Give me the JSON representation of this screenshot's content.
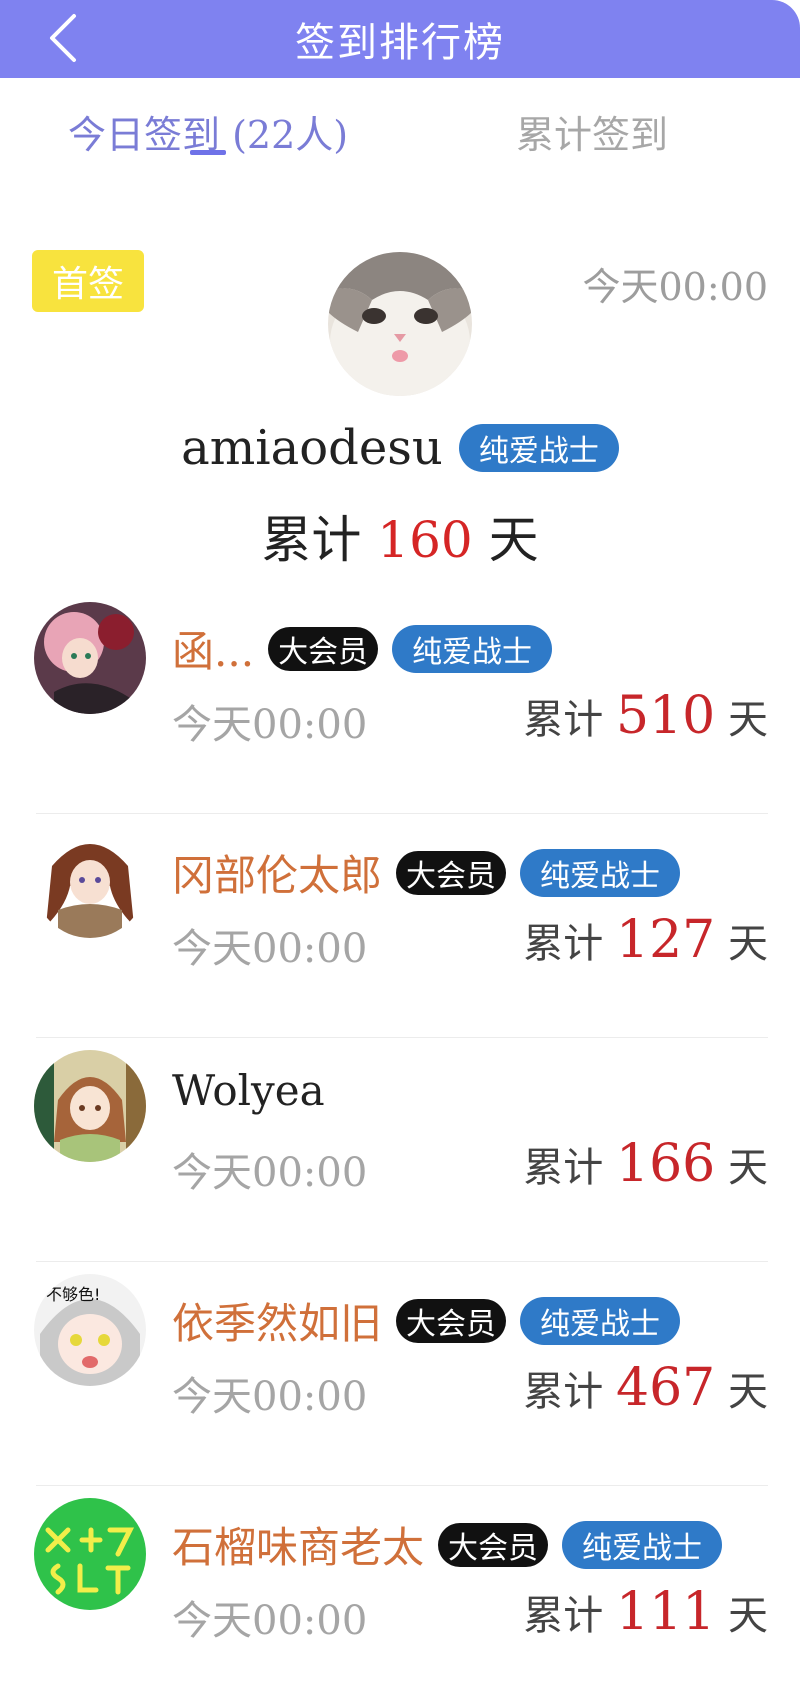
{
  "header": {
    "title": "签到排行榜"
  },
  "tabs": [
    {
      "label": "今日签到 (22人)"
    },
    {
      "label": "累计签到"
    }
  ],
  "first": {
    "badge": "首签",
    "time": "今天00:00",
    "name": "amiaodesu",
    "tag": "纯爱战士",
    "total_prefix": "累计",
    "total_days": "160",
    "total_suffix": "天"
  },
  "labels": {
    "total_prefix": "累计",
    "total_suffix": "天"
  },
  "list": [
    {
      "name": "函...",
      "vip": "大会员",
      "tag": "纯爱战士",
      "time": "今天00:00",
      "days": "510"
    },
    {
      "name": "冈部伦太郎",
      "vip": "大会员",
      "tag": "纯爱战士",
      "time": "今天00:00",
      "days": "127"
    },
    {
      "name": "Wolyea",
      "vip": "",
      "tag": "",
      "time": "今天00:00",
      "days": "166"
    },
    {
      "name": "依季然如旧",
      "vip": "大会员",
      "tag": "纯爱战士",
      "time": "今天00:00",
      "days": "467"
    },
    {
      "name": "石榴味商老太",
      "vip": "大会员",
      "tag": "纯爱战士",
      "time": "今天00:00",
      "days": "111"
    }
  ],
  "avatar_text": {
    "row4": "不够色!"
  },
  "colors": {
    "header_bg": "#7f82f0",
    "accent": "#6f72e8",
    "badge_yellow": "#f8e33e",
    "tag_blue": "#2f7ac8",
    "name_orange": "#d0703a",
    "days_red": "#c7262a"
  }
}
